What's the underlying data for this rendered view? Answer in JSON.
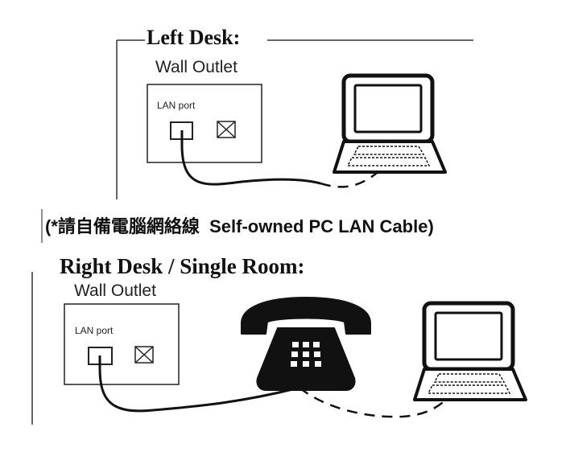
{
  "left_desk": {
    "title": "Left Desk:",
    "outlet_label": "Wall Outlet",
    "port_label": "LAN port"
  },
  "note": {
    "text": "(*請自備電腦網絡線  Self-owned PC LAN Cable)"
  },
  "right_desk": {
    "title": "Right Desk / Single Room:",
    "outlet_label": "Wall Outlet",
    "port_label": "LAN port"
  }
}
